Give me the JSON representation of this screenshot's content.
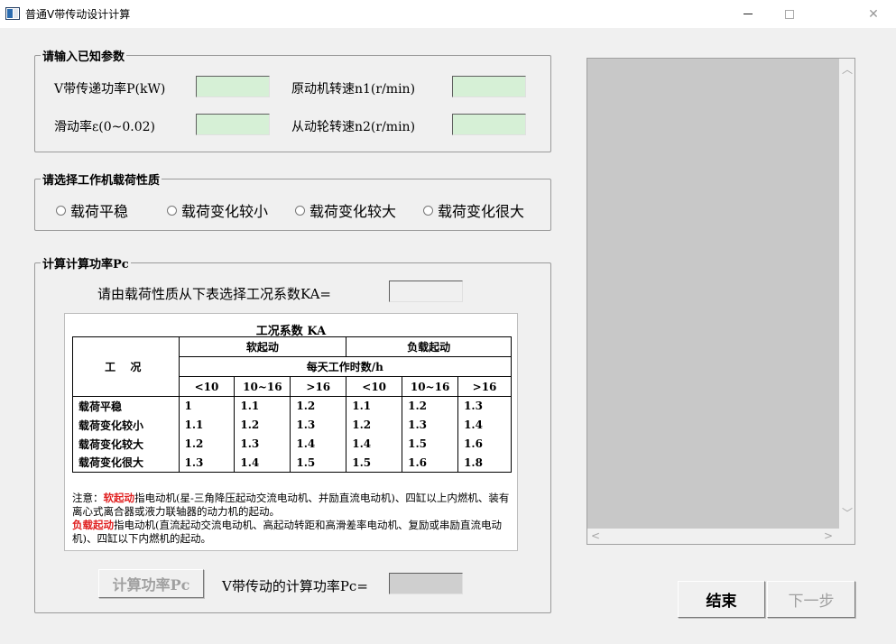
{
  "window": {
    "title": "普通V带传动设计计算",
    "minimize_glyph": "—",
    "maximize_glyph": "☐",
    "close_glyph": "✕"
  },
  "known_params": {
    "legend": "请输入已知参数",
    "power_label": "V带传递功率P(kW)",
    "power_value": "",
    "motor_speed_label": "原动机转速n1(r/min)",
    "motor_speed_value": "",
    "slip_label": "滑动率ε(0~0.02)",
    "slip_value": "",
    "driven_speed_label": "从动轮转速n2(r/min)",
    "driven_speed_value": ""
  },
  "load_type": {
    "legend": "请选择工作机载荷性质",
    "options": [
      "载荷平稳",
      "载荷变化较小",
      "载荷变化较大",
      "载荷变化很大"
    ]
  },
  "calc": {
    "legend": "计算计算功率Pc",
    "ka_prompt": "请由载荷性质从下表选择工况系数KA=",
    "ka_value": "",
    "calc_button": "计算功率Pc",
    "pc_label": "V带传动的计算功率Pc=",
    "pc_value": ""
  },
  "ka_table": {
    "title": "工况系数 KA",
    "condition_header": "工 况",
    "soft_start": "软起动",
    "load_start": "负载起动",
    "hours_header": "每天工作时数/h",
    "hour_cols": [
      "<10",
      "10~16",
      ">16",
      "<10",
      "10~16",
      ">16"
    ],
    "rows": [
      {
        "name": "载荷平稳",
        "v": [
          "1",
          "1.1",
          "1.2",
          "1.1",
          "1.2",
          "1.3"
        ]
      },
      {
        "name": "载荷变化较小",
        "v": [
          "1.1",
          "1.2",
          "1.3",
          "1.2",
          "1.3",
          "1.4"
        ]
      },
      {
        "name": "载荷变化较大",
        "v": [
          "1.2",
          "1.3",
          "1.4",
          "1.4",
          "1.5",
          "1.6"
        ]
      },
      {
        "name": "载荷变化很大",
        "v": [
          "1.3",
          "1.4",
          "1.5",
          "1.5",
          "1.6",
          "1.8"
        ]
      }
    ],
    "note_prefix": "注意：",
    "note_soft_term": "软起动",
    "note_soft_text": "指电动机(星-三角降压起动交流电动机、并励直流电动机)、四缸以上内燃机、装有离心式离合器或液力联轴器的动力机的起动。",
    "note_load_term": "负载起动",
    "note_load_text": "指电动机(直流起动交流电动机、高起动转距和高滑差率电动机、复励或串励直流电动机)、四缸以下内燃机的起动。"
  },
  "output": {
    "text": ""
  },
  "footer": {
    "finish_button": "结束",
    "next_button": "下一步"
  }
}
